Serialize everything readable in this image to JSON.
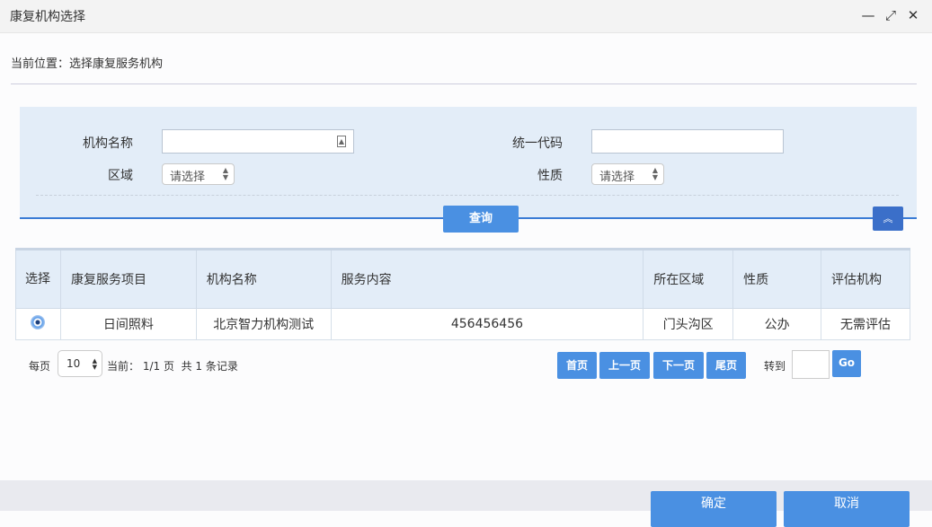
{
  "window": {
    "title": "康复机构选择",
    "minimize_icon": "minimize-icon",
    "maximize_icon": "maximize-icon",
    "close_icon": "close-icon"
  },
  "breadcrumb": "当前位置：选择康复服务机构",
  "search": {
    "org_name_label": "机构名称",
    "org_name_value": "",
    "code_label": "统一代码",
    "code_value": "",
    "area_label": "区域",
    "area_value": "请选择",
    "nature_label": "性质",
    "nature_value": "请选择",
    "query_label": "查询"
  },
  "table": {
    "headers": [
      "选择",
      "康复服务项目",
      "机构名称",
      "服务内容",
      "所在区域",
      "性质",
      "评估机构"
    ],
    "rows": [
      [
        "",
        "日间照料",
        "北京智力机构测试",
        "456456456",
        "门头沟区",
        "公办",
        "无需评估"
      ]
    ]
  },
  "pagination": {
    "per_page_label": "每页",
    "per_page_value": "10",
    "status": "当前： 1/1 页  共 1 条记录",
    "first": "首页",
    "prev": "上一页",
    "next": "下一页",
    "last": "尾页",
    "goto_label": "转到",
    "goto_value": "",
    "go": "Go"
  },
  "footer": {
    "confirm": "确定",
    "cancel": "取消"
  },
  "colors": {
    "accent": "#4a90e2",
    "panel": "#e3edf8"
  }
}
